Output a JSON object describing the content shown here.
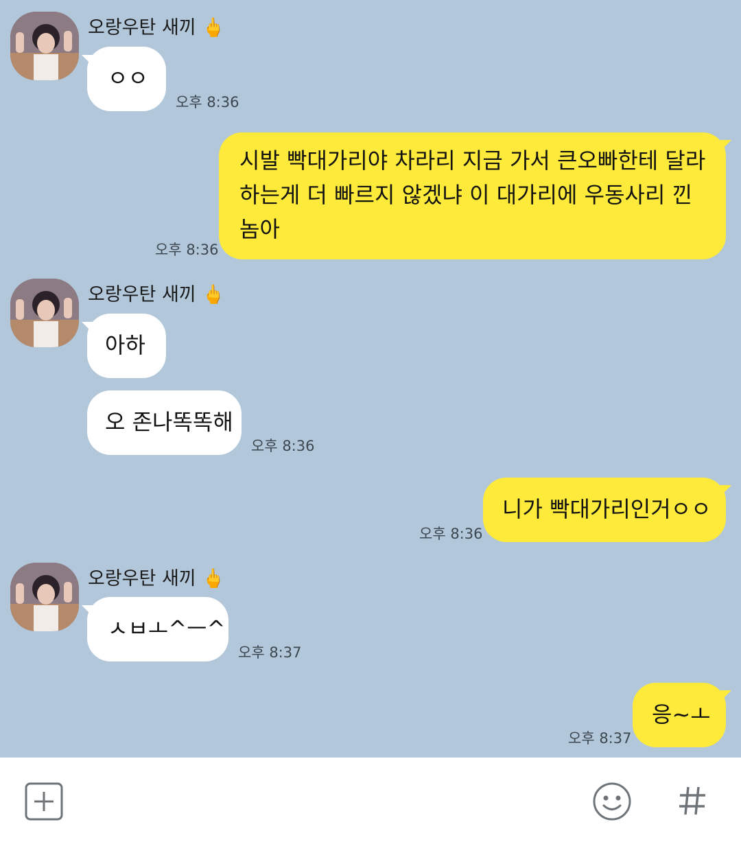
{
  "sender": {
    "name": "오랑우탄 새끼",
    "badge": "🖕"
  },
  "messages": [
    {
      "id": "m1",
      "direction": "in",
      "text": "ㅇㅇ",
      "time": "오후 8:36"
    },
    {
      "id": "m2",
      "direction": "out",
      "text": "시발 빡대가리야 차라리 지금 가서 큰오빠한테 달라하는게 더 빠르지 않겠냐 이 대가리에 우동사리 낀놈아",
      "time": "오후 8:36"
    },
    {
      "id": "m3",
      "direction": "in",
      "text": "아하",
      "time": ""
    },
    {
      "id": "m4",
      "direction": "in",
      "text": "오 존나똑똑해",
      "time": "오후 8:36"
    },
    {
      "id": "m5",
      "direction": "out",
      "text": "니가 빡대가리인거ㅇㅇ",
      "time": "오후 8:36"
    },
    {
      "id": "m6",
      "direction": "in",
      "text": "ㅅㅂㅗ^ㅡ^",
      "time": "오후 8:37"
    },
    {
      "id": "m7",
      "direction": "out",
      "text": "응~ㅗ",
      "time": "오후 8:37"
    }
  ],
  "input_bar": {
    "icons": [
      "plus-icon",
      "emoji-icon",
      "hashtag-icon"
    ]
  },
  "colors": {
    "background": "#b2c7da",
    "bubble_in": "#ffffff",
    "bubble_out": "#fdea3a"
  }
}
